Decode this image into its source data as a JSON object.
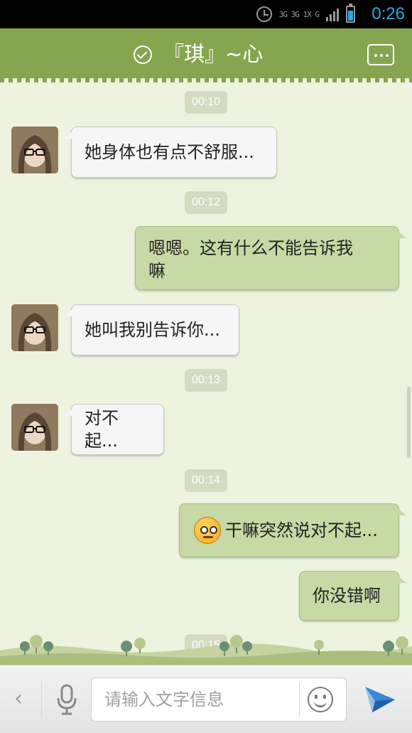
{
  "status_bar": {
    "network_text": "3G 3G 1X G",
    "time": "0:26",
    "battery_color": "#29a9e0"
  },
  "header": {
    "title": "『琪』~心",
    "accent_color": "#85a54f",
    "status_icon": "check-circle-icon",
    "menu_icon": "more-icon"
  },
  "messages": [
    {
      "type": "time",
      "text": "00:10"
    },
    {
      "type": "received",
      "text": "她身体也有点不舒服..."
    },
    {
      "type": "time",
      "text": "00:12"
    },
    {
      "type": "sent",
      "line1": "嗯嗯。这有什么不能告诉我",
      "line2": "嘛"
    },
    {
      "type": "received",
      "text": "她叫我别告诉你..."
    },
    {
      "type": "time",
      "text": "00:13"
    },
    {
      "type": "received",
      "text": "对不起..."
    },
    {
      "type": "time",
      "text": "00:14"
    },
    {
      "type": "sent",
      "emoji": "angry-face-icon",
      "text": "干嘛突然说对不起..."
    },
    {
      "type": "sent",
      "text": "你没错啊"
    },
    {
      "type": "time",
      "text": "00:15"
    }
  ],
  "input_bar": {
    "placeholder": "请输入文字信息",
    "value": ""
  }
}
